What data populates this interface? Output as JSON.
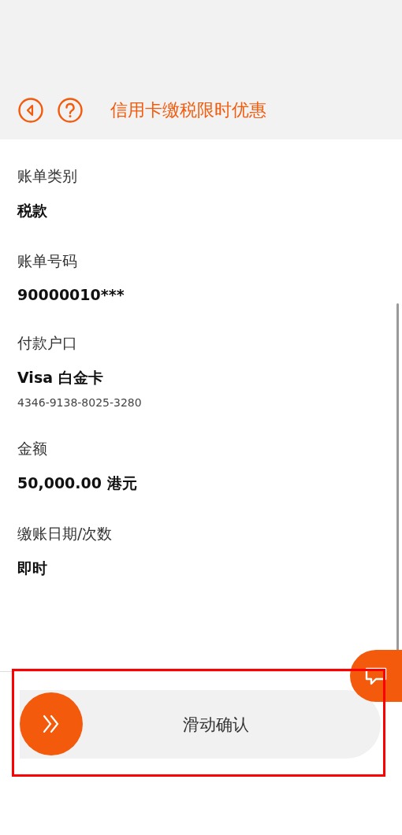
{
  "header": {
    "title": "信用卡缴税限时优惠"
  },
  "fields": [
    {
      "label": "账单类别",
      "value": "税款"
    },
    {
      "label": "账单号码",
      "value": "90000010***"
    },
    {
      "label": "付款户口",
      "value": "Visa 白金卡",
      "detail": "4346-9138-8025-3280"
    },
    {
      "label": "金额",
      "value": "50,000.00 港元"
    },
    {
      "label": "缴账日期/次数",
      "value": "即时"
    }
  ],
  "slider": {
    "label": "滑动确认",
    "level": 0,
    "highlighted": true
  }
}
